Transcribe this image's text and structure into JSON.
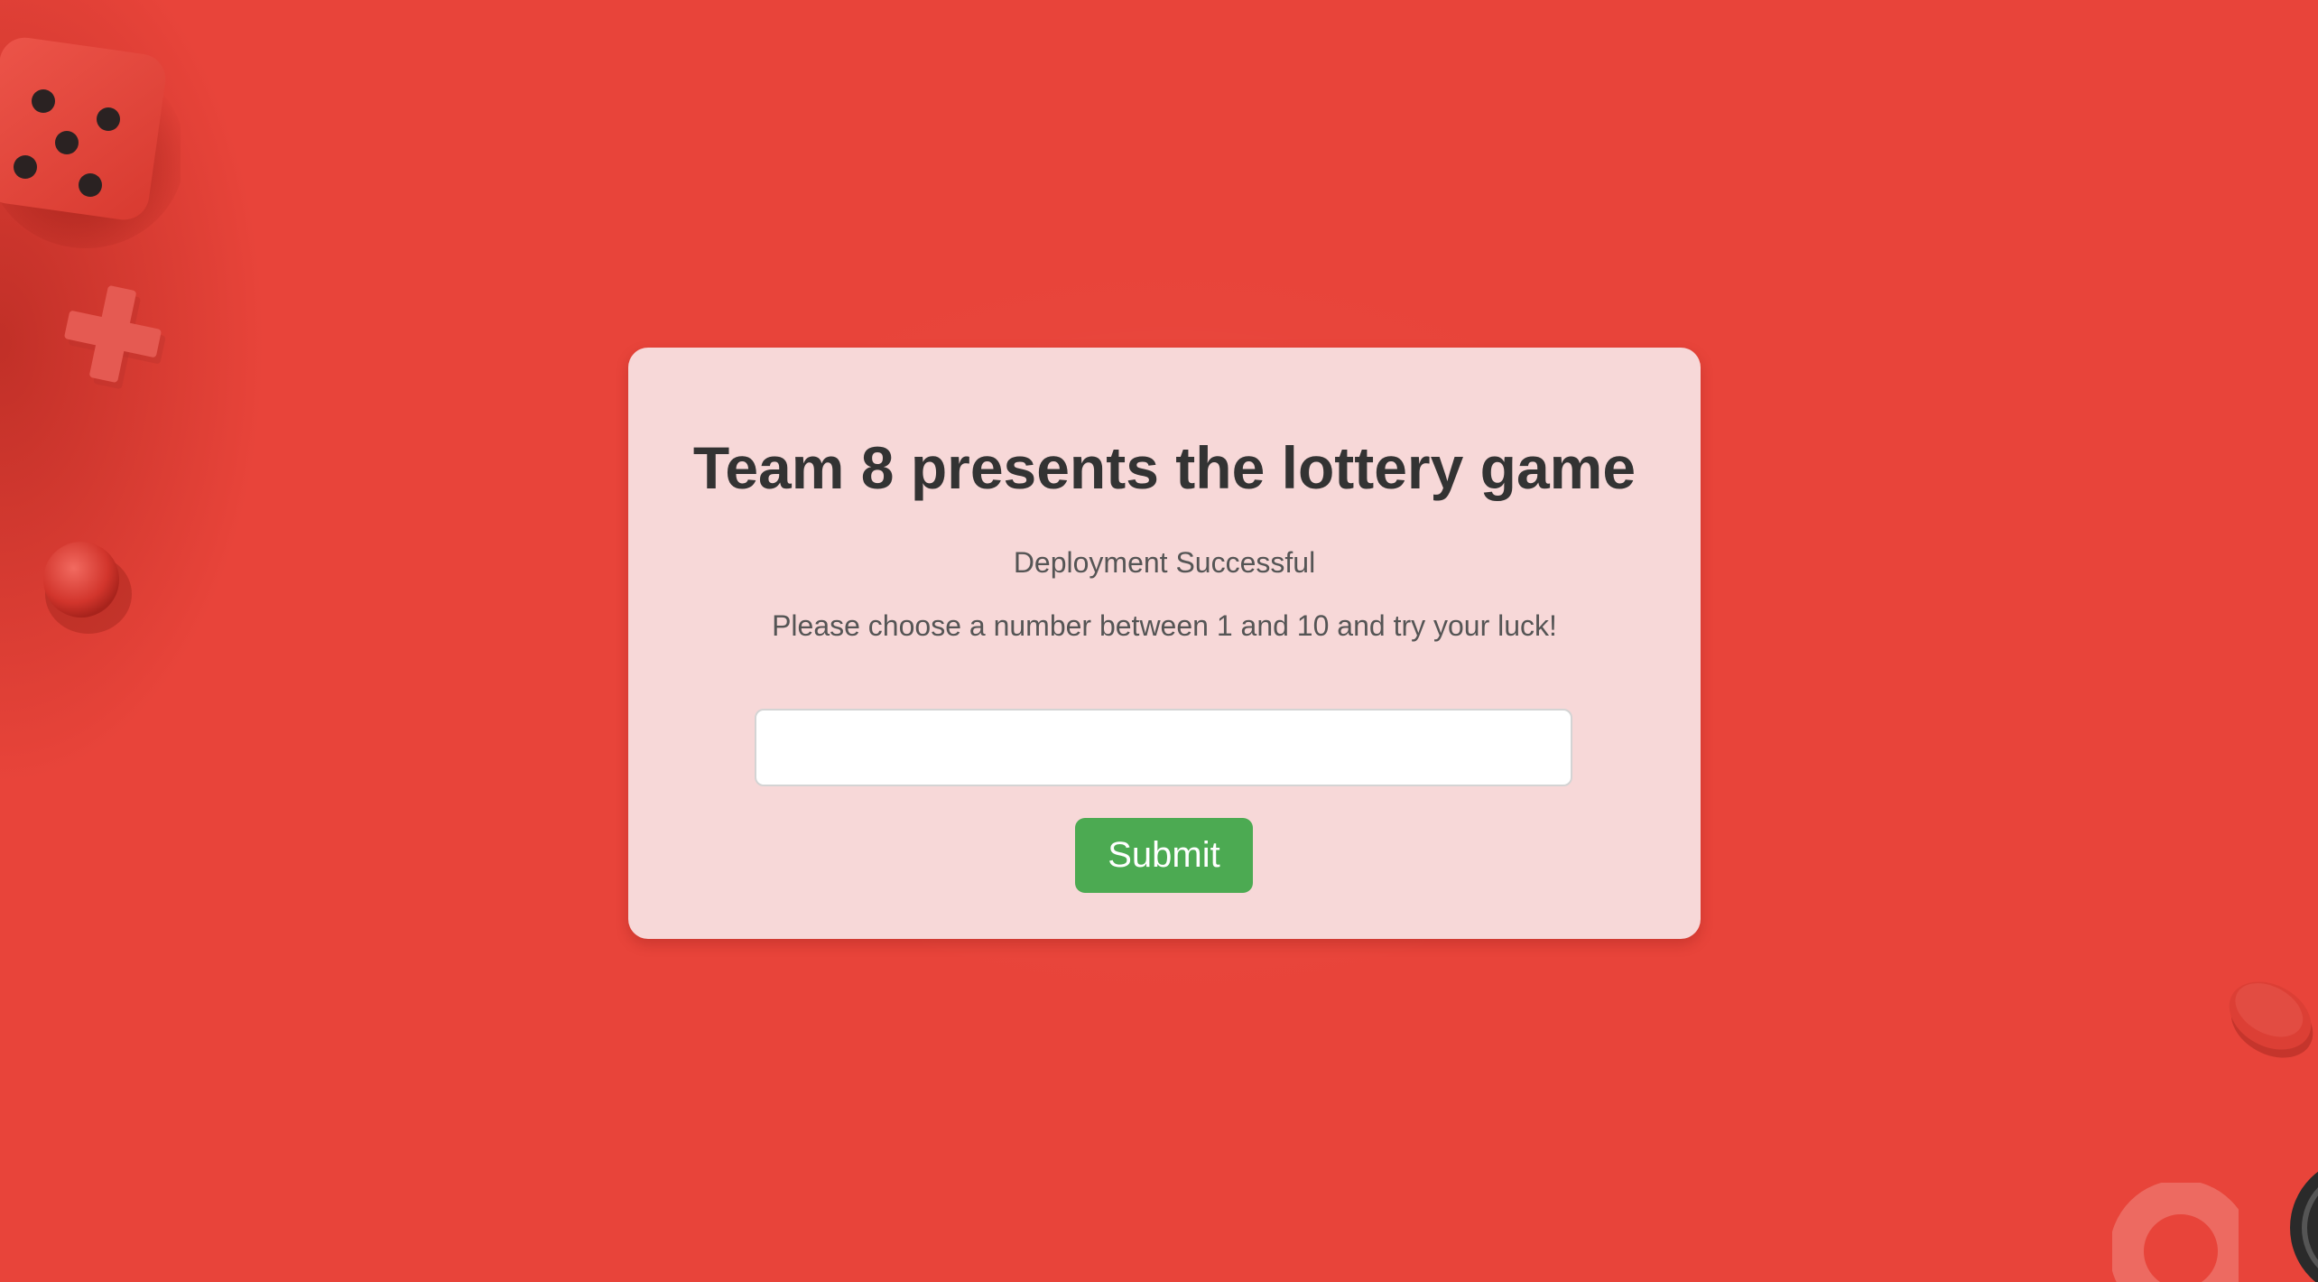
{
  "page": {
    "title": "Team 8 presents the lottery game",
    "subtitle": "Deployment Successful",
    "instruction": "Please choose a number between 1 and 10 and try your luck!"
  },
  "form": {
    "number_value": "",
    "number_placeholder": "",
    "submit_label": "Submit"
  },
  "colors": {
    "background": "#e8443a",
    "card": "#f7d8d8",
    "title_text": "#333333",
    "body_text": "#555555",
    "submit_button": "#4caa52",
    "submit_text": "#ffffff"
  },
  "decorations": [
    "dice-icon",
    "plus-shape-icon",
    "ball-icon",
    "disc-piece-icon",
    "ring-piece-icon",
    "black-piece-icon"
  ]
}
